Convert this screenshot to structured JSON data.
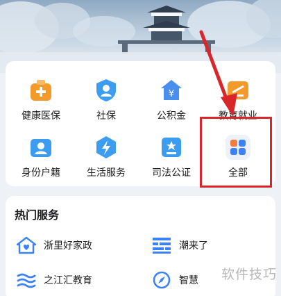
{
  "services": {
    "items": [
      {
        "label": "健康医保",
        "icon": "medical-kit-icon",
        "color": "#f49a2a"
      },
      {
        "label": "社保",
        "icon": "shield-user-icon",
        "color": "#3b9cf0"
      },
      {
        "label": "公积金",
        "icon": "house-yuan-icon",
        "color": "#4a8ff0"
      },
      {
        "label": "教育就业",
        "icon": "certificate-icon",
        "color": "#f49a2a"
      },
      {
        "label": "身份户籍",
        "icon": "id-card-icon",
        "color": "#3b9cf0"
      },
      {
        "label": "生活服务",
        "icon": "lightning-icon",
        "color": "#3b9cf0"
      },
      {
        "label": "司法公证",
        "icon": "document-star-icon",
        "color": "#3b9cf0"
      },
      {
        "label": "全部",
        "icon": "grid-apps-icon",
        "color": "#f57a3d"
      }
    ]
  },
  "hot": {
    "title": "热门服务",
    "items": [
      {
        "label": "浙里好家政",
        "icon": "home-heart-icon"
      },
      {
        "label": "潮来了",
        "icon": "wave-grid-icon"
      },
      {
        "label": "之江汇教育",
        "icon": "waves-icon"
      },
      {
        "label": "智慧",
        "icon": "compass-icon"
      }
    ]
  },
  "watermark": "软件技巧",
  "colors": {
    "accent_red": "#d9262a",
    "icon_blue": "#3b82f6"
  }
}
